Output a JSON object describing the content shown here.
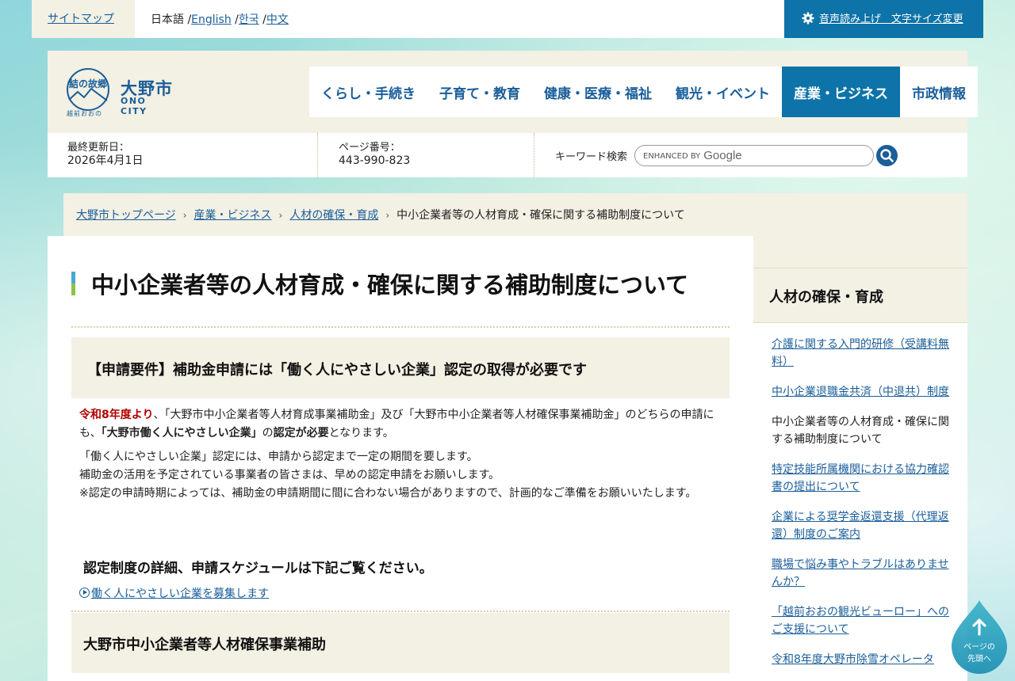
{
  "topbar": {
    "sitemap": "サイトマップ",
    "lang_current": "日本語",
    "langs": [
      "English",
      "한국",
      "中文"
    ],
    "voice_label": "音声読み上げ　文字サイズ変更"
  },
  "header": {
    "logo_jp": "大野市",
    "logo_en": "ONO CITY",
    "logo_mark_text": "結の故郷",
    "logo_sub": "越前おおの",
    "nav": [
      {
        "label": "くらし・手続き",
        "active": false
      },
      {
        "label": "子育て・教育",
        "active": false
      },
      {
        "label": "健康・医療・福祉",
        "active": false
      },
      {
        "label": "観光・イベント",
        "active": false
      },
      {
        "label": "産業・ビジネス",
        "active": true
      },
      {
        "label": "市政情報",
        "active": false
      }
    ]
  },
  "info": {
    "updated_label": "最終更新日：",
    "updated_value": "2026年4月1日",
    "page_no_label": "ページ番号：",
    "page_no_value": "443-990-823",
    "search_label": "キーワード検索",
    "search_placeholder_prefix": "ENHANCED BY",
    "search_placeholder_brand": "Google"
  },
  "breadcrumb": [
    "大野市トップページ",
    "産業・ビジネス",
    "人材の確保・育成",
    "中小企業者等の人材育成・確保に関する補助制度について"
  ],
  "main": {
    "title": "中小企業者等の人材育成・確保に関する補助制度について",
    "section1_heading": "【申請要件】補助金申請には「働く人にやさしい企業」認定の取得が必要です",
    "p1_red": "令和8年度より",
    "p1_a": "、「大野市中小企業者等人材育成事業補助金」及び「大野市中小企業者等人材確保事業補助金」のどちらの申請にも、",
    "p1_bold1": "「大野市働く人にやさしい企業」",
    "p1_b": "の",
    "p1_bold2": "認定が必要",
    "p1_c": "となります。",
    "p2_line1": "「働く人にやさしい企業」認定には、申請から認定まで一定の期間を要します。",
    "p2_line2": "補助金の活用を予定されている事業者の皆さまは、早めの認定申請をお願いします。",
    "p2_line3": "※認定の申請時期によっては、補助金の申請期間に間に合わない場合がありますので、計画的なご準備をお願いいたします。",
    "h3": "認定制度の詳細、申請スケジュールは下記ご覧ください。",
    "link": "働く人にやさしい企業を募集します",
    "section2_heading": "大野市中小企業者等人材確保事業補助"
  },
  "side": {
    "heading": "人材の確保・育成",
    "items": [
      {
        "label": "介護に関する入門的研修（受講料無料）",
        "link": true
      },
      {
        "label": "中小企業退職金共済（中退共）制度",
        "link": true
      },
      {
        "label": "中小企業者等の人材育成・確保に関する補助制度について",
        "link": false
      },
      {
        "label": "特定技能所属機関における協力確認書の提出について",
        "link": true
      },
      {
        "label": "企業による奨学金返還支援（代理返還）制度のご案内",
        "link": true
      },
      {
        "label": "職場で悩み事やトラブルはありませんか？",
        "link": true
      },
      {
        "label": "「越前おおの観光ビューロー」へのご支援について",
        "link": true
      },
      {
        "label": "令和8年度大野市除雪オペレータ",
        "link": true
      }
    ]
  },
  "pagetop": {
    "line1": "ページの",
    "line2": "先頭へ"
  }
}
